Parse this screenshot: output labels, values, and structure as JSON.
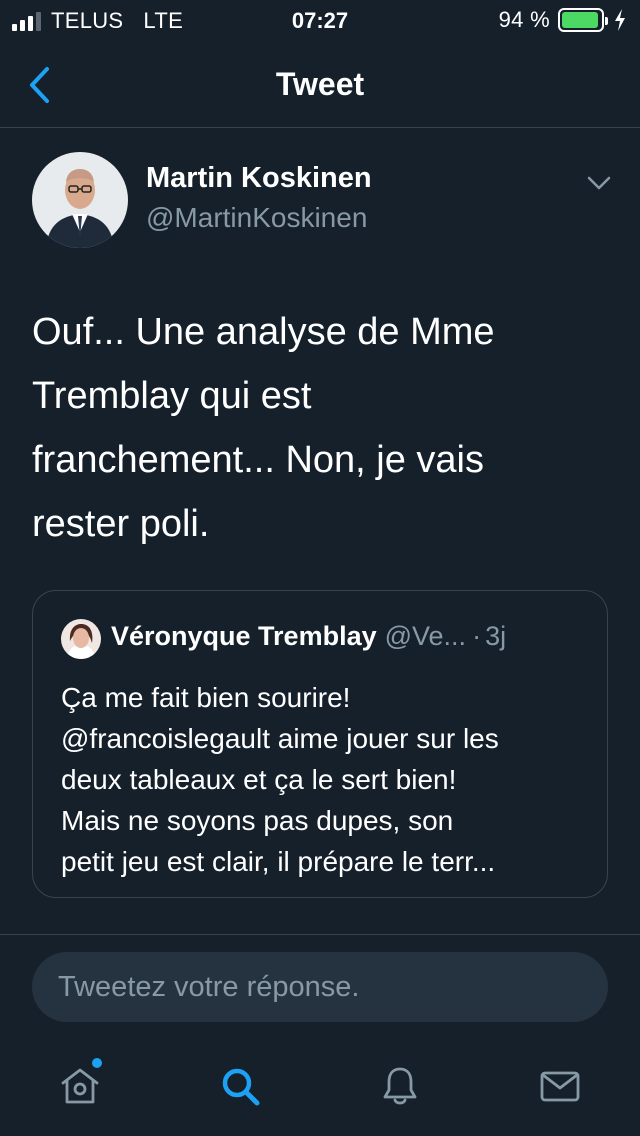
{
  "status_bar": {
    "carrier": "TELUS",
    "network": "LTE",
    "time": "07:27",
    "battery_text": "94 %",
    "battery_level": 0.94
  },
  "nav": {
    "title": "Tweet"
  },
  "tweet": {
    "author_name": "Martin Koskinen",
    "author_handle": "@MartinKoskinen",
    "text": "Ouf...  Une analyse de Mme\nTremblay qui est\nfranchement...  Non, je vais\nrester poli."
  },
  "quoted_tweet": {
    "author_name": "Véronyque Tremblay",
    "author_handle": "@Ve...",
    "separator": "·",
    "time": "3j",
    "text": "Ça me fait bien sourire!\n@francoislegault aime jouer sur les\ndeux tableaux et ça le sert bien!\nMais ne soyons pas dupes, son\npetit jeu est clair, il prépare le terr..."
  },
  "reply": {
    "placeholder": "Tweetez votre réponse."
  },
  "tab_bar": {
    "icons": [
      "home-icon",
      "search-icon",
      "bell-icon",
      "mail-icon"
    ],
    "active": "search-icon"
  },
  "colors": {
    "background": "#15202b",
    "border": "#38444d",
    "accent": "#1da1f2",
    "secondary_text": "#8899a6",
    "battery": "#4cd964"
  }
}
